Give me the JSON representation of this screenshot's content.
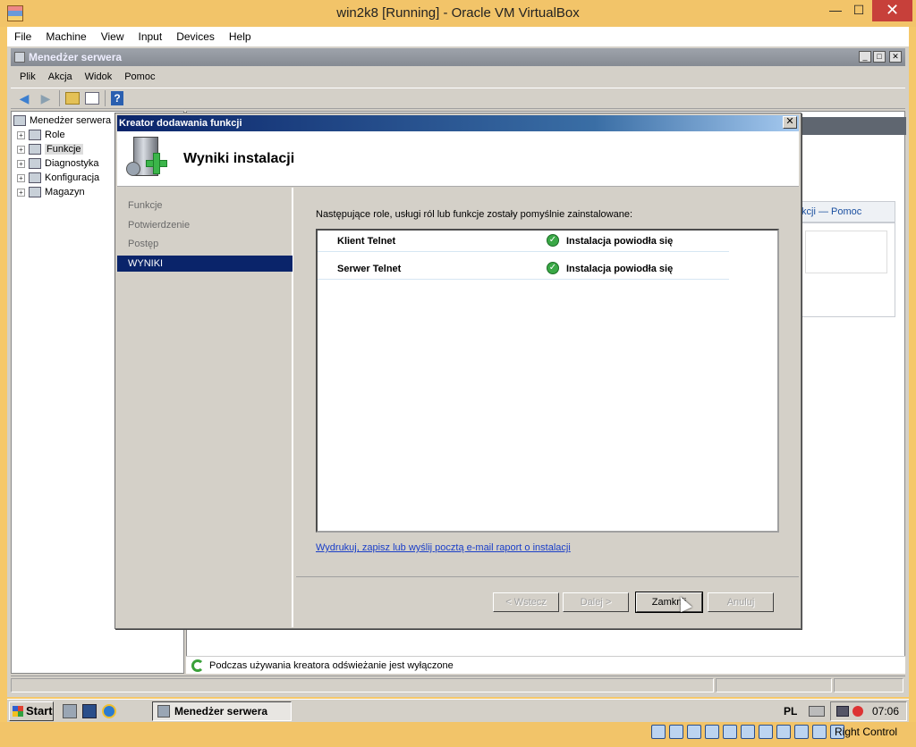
{
  "host": {
    "title": "win2k8 [Running] - Oracle VM VirtualBox",
    "min": "—",
    "max": "☐",
    "close": "✕",
    "menu": [
      "File",
      "Machine",
      "View",
      "Input",
      "Devices",
      "Help"
    ],
    "status_label": "Right Control"
  },
  "server_manager": {
    "title": "Menedżer serwera",
    "window_min": "_",
    "window_max": "□",
    "window_close": "✕",
    "menu": [
      "Plik",
      "Akcja",
      "Widok",
      "Pomoc"
    ],
    "tree": [
      {
        "label": "Menedżer serwera",
        "expander": ""
      },
      {
        "label": "Role",
        "expander": "+"
      },
      {
        "label": "Funkcje",
        "expander": "+"
      },
      {
        "label": "Diagnostyka",
        "expander": "+"
      },
      {
        "label": "Konfiguracja",
        "expander": "+"
      },
      {
        "label": "Magazyn",
        "expander": "+"
      }
    ],
    "right_help": "kcji — Pomoc",
    "status_text": "Podczas używania kreatora odświeżanie jest wyłączone"
  },
  "wizard": {
    "title": "Kreator dodawania funkcji",
    "close": "✕",
    "header_title": "Wyniki instalacji",
    "steps": [
      "Funkcje",
      "Potwierdzenie",
      "Postęp",
      "WYNIKI"
    ],
    "intro": "Następujące role, usługi ról lub funkcje zostały pomyślnie zainstalowane:",
    "results": [
      {
        "name": "Klient Telnet",
        "status": "Instalacja powiodła się"
      },
      {
        "name": "Serwer Telnet",
        "status": "Instalacja powiodła się"
      }
    ],
    "ok_mark": "✓",
    "report_link": "Wydrukuj, zapisz lub wyślij pocztą e-mail raport o instalacji",
    "buttons": {
      "back": "< Wstecz",
      "next": "Dalej >",
      "close": "Zamknij",
      "cancel": "Anuluj"
    }
  },
  "taskbar": {
    "start": "Start",
    "task": "Menedżer serwera",
    "lang": "PL",
    "clock": "07:06"
  }
}
